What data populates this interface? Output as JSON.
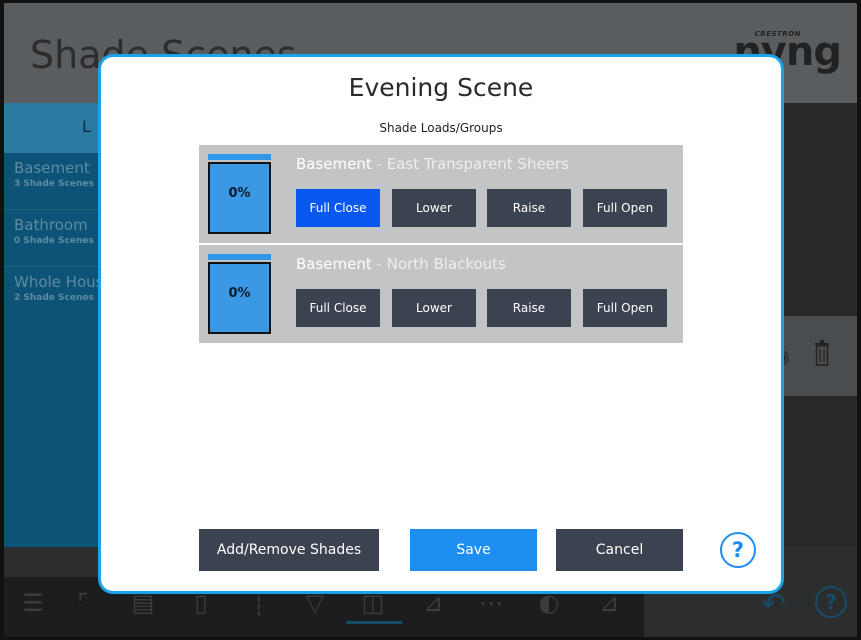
{
  "app": {
    "title": "Shade Scenes",
    "brand_small": "CRESTRON",
    "brand_big": "nyng",
    "left_header": "L",
    "scenes": [
      {
        "name": "Basement",
        "count": "3 Shade Scenes"
      },
      {
        "name": "Bathroom",
        "count": "0 Shade Scenes"
      },
      {
        "name": "Whole House",
        "count": "2 Shade Scenes"
      }
    ]
  },
  "modal": {
    "title": "Evening Scene",
    "subtitle": "Shade Loads/Groups",
    "loads": [
      {
        "room": "Basement",
        "separator": " - ",
        "name": "East Transparent Sheers",
        "level": "0%",
        "buttons": {
          "full_close": "Full Close",
          "lower": "Lower",
          "raise": "Raise",
          "full_open": "Full Open"
        },
        "selected": "full_close"
      },
      {
        "room": "Basement",
        "separator": " - ",
        "name": "North Blackouts",
        "level": "0%",
        "buttons": {
          "full_close": "Full Close",
          "lower": "Lower",
          "raise": "Raise",
          "full_open": "Full Open"
        },
        "selected": null
      }
    ],
    "footer": {
      "add_remove": "Add/Remove Shades",
      "save": "Save",
      "cancel": "Cancel",
      "help": "?"
    }
  },
  "bottom": {
    "help": "?"
  },
  "colors": {
    "accent": "#1d8df0",
    "selected_button": "#0a58f0",
    "button_dark": "#3b4350",
    "row_bg": "#c2c4c6",
    "modal_border": "#1aa3e8"
  }
}
